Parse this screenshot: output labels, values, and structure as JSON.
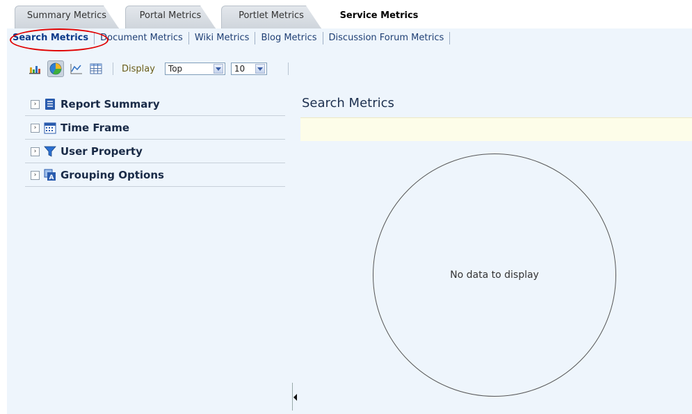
{
  "top_tabs": [
    {
      "label": "Summary Metrics"
    },
    {
      "label": "Portal Metrics"
    },
    {
      "label": "Portlet Metrics"
    },
    {
      "label": "Service Metrics",
      "active": true
    }
  ],
  "sub_tabs": [
    {
      "label": "Search Metrics"
    },
    {
      "label": "Document Metrics"
    },
    {
      "label": "Wiki Metrics"
    },
    {
      "label": "Blog Metrics"
    },
    {
      "label": "Discussion Forum Metrics"
    }
  ],
  "toolbar": {
    "icons": [
      "bar-chart-icon",
      "pie-chart-icon",
      "line-chart-icon",
      "table-icon"
    ],
    "selected_view": "pie-chart-icon",
    "display_label": "Display",
    "display_select": "Top",
    "count_select": "10"
  },
  "accordion": [
    {
      "label": "Report Summary",
      "icon": "report-summary-icon"
    },
    {
      "label": "Time Frame",
      "icon": "calendar-icon"
    },
    {
      "label": "User Property",
      "icon": "filter-icon"
    },
    {
      "label": "Grouping Options",
      "icon": "grouping-icon"
    }
  ],
  "panel": {
    "title": "Search Metrics",
    "empty_message": "No data to display"
  },
  "colors": {
    "content_bg": "#eef5fc",
    "annotation": "#e00000",
    "link": "#1f3f74"
  }
}
